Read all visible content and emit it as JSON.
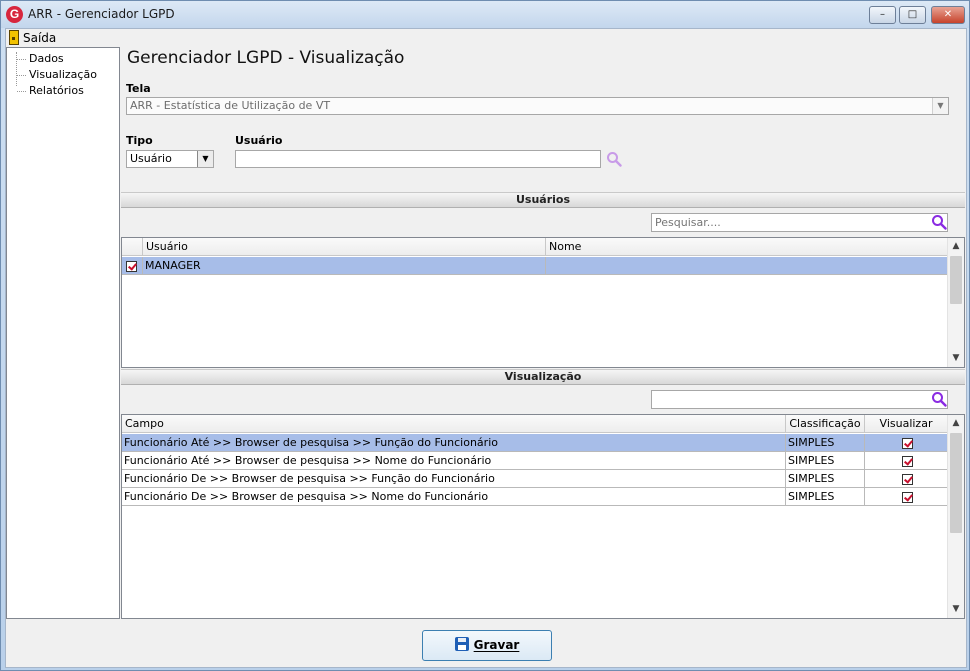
{
  "window": {
    "title": "ARR - Gerenciador LGPD",
    "app_icon_letter": "G"
  },
  "menu": {
    "exit_label": "Saída"
  },
  "tree": {
    "items": [
      {
        "label": "Dados"
      },
      {
        "label": "Visualização"
      },
      {
        "label": "Relatórios"
      }
    ]
  },
  "main": {
    "title": "Gerenciador LGPD - Visualização",
    "tela_label": "Tela",
    "tela_value": "ARR - Estatística de Utilização de VT",
    "tipo_label": "Tipo",
    "tipo_value": "Usuário",
    "usuario_label": "Usuário",
    "usuario_value": ""
  },
  "users_section": {
    "title": "Usuários",
    "search_placeholder": "Pesquisar....",
    "columns": [
      "Usuário",
      "Nome"
    ],
    "rows": [
      {
        "checked": true,
        "usuario": "MANAGER",
        "nome": ""
      }
    ]
  },
  "view_section": {
    "title": "Visualização",
    "search_value": "",
    "columns": [
      "Campo",
      "Classificação",
      "Visualizar"
    ],
    "rows": [
      {
        "campo": "Funcionário Até >> Browser de pesquisa >> Função do Funcionário",
        "classificacao": "SIMPLES",
        "visualizar": true
      },
      {
        "campo": "Funcionário Até >> Browser de pesquisa >> Nome do Funcionário",
        "classificacao": "SIMPLES",
        "visualizar": true
      },
      {
        "campo": "Funcionário De >> Browser de pesquisa >> Função do Funcionário",
        "classificacao": "SIMPLES",
        "visualizar": true
      },
      {
        "campo": "Funcionário De >> Browser de pesquisa >> Nome do Funcionário",
        "classificacao": "SIMPLES",
        "visualizar": true
      }
    ]
  },
  "footer": {
    "save_label": "Gravar"
  },
  "colors": {
    "selected_row": "#a7bde8",
    "search_icon": "#8a2be2",
    "check_mark": "#c8102e"
  }
}
